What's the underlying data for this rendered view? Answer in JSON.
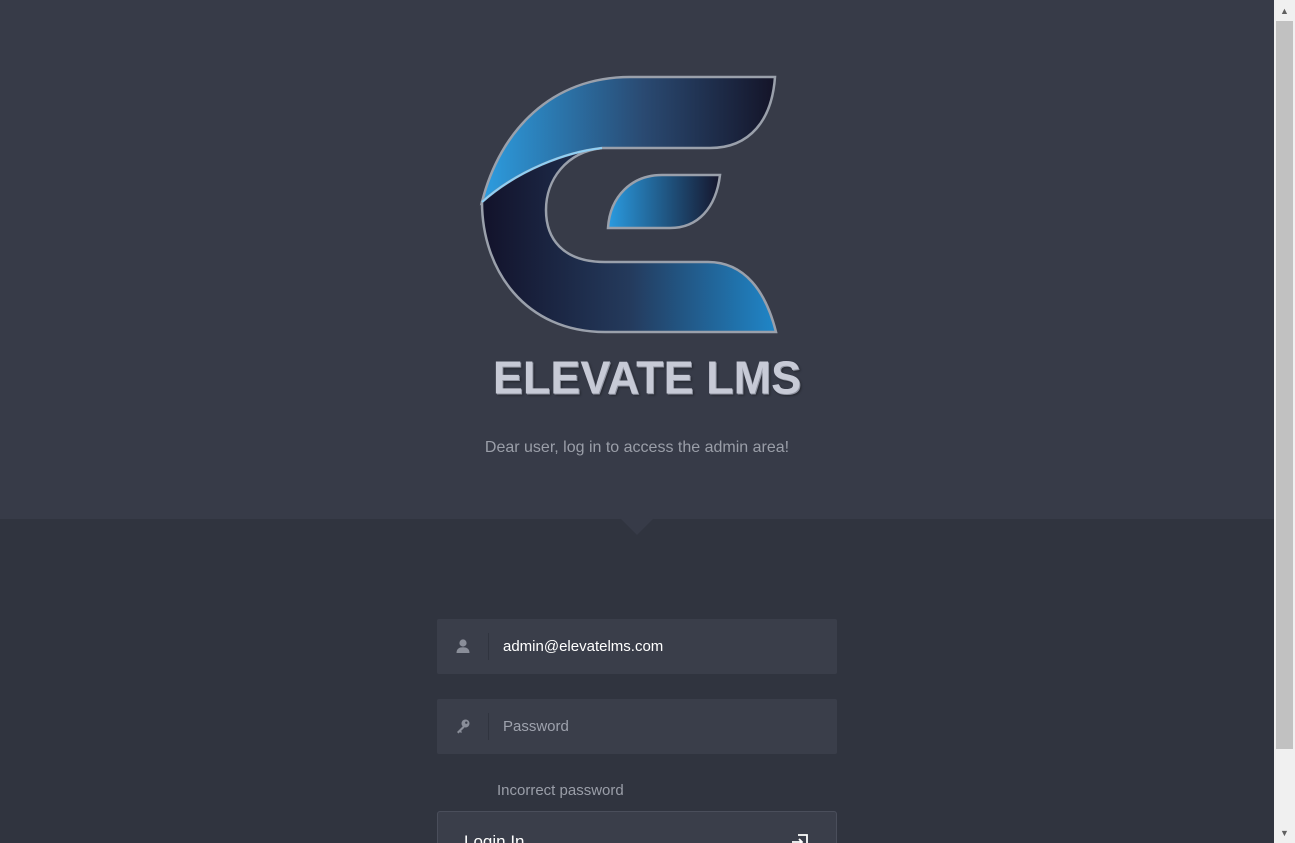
{
  "brand": {
    "name": "ELEVATE LMS",
    "logo_icon": "elevate-e-logo",
    "colors": {
      "blue": "#2a8ed1",
      "navy": "#1a1d36",
      "background_top": "#373b48",
      "background_bottom": "#30343f"
    }
  },
  "header": {
    "subtitle": "Dear user, log in to access the admin area!"
  },
  "form": {
    "email": {
      "icon": "user-icon",
      "value": "admin@elevatelms.com",
      "placeholder": ""
    },
    "password": {
      "icon": "key-icon",
      "value": "",
      "placeholder": "Password"
    },
    "error": "Incorrect password",
    "submit": {
      "label": "Login In",
      "icon": "login-icon"
    }
  }
}
